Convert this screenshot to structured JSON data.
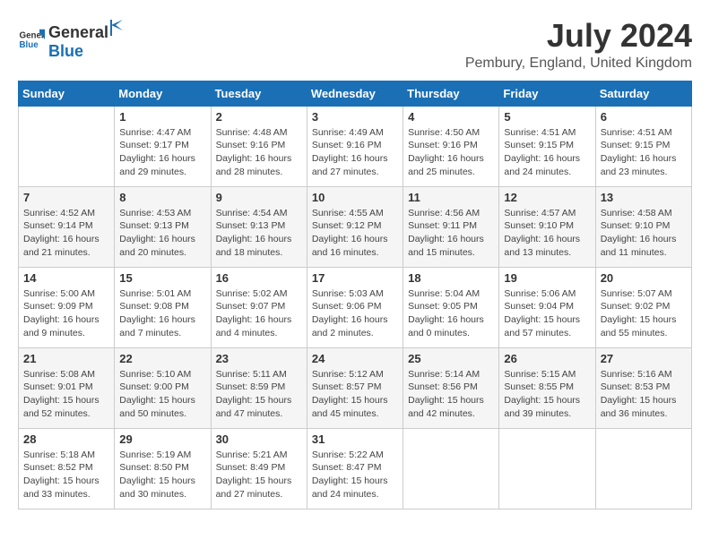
{
  "logo": {
    "general": "General",
    "blue": "Blue"
  },
  "title": "July 2024",
  "location": "Pembury, England, United Kingdom",
  "days_of_week": [
    "Sunday",
    "Monday",
    "Tuesday",
    "Wednesday",
    "Thursday",
    "Friday",
    "Saturday"
  ],
  "weeks": [
    [
      {
        "day": "",
        "info": ""
      },
      {
        "day": "1",
        "info": "Sunrise: 4:47 AM\nSunset: 9:17 PM\nDaylight: 16 hours\nand 29 minutes."
      },
      {
        "day": "2",
        "info": "Sunrise: 4:48 AM\nSunset: 9:16 PM\nDaylight: 16 hours\nand 28 minutes."
      },
      {
        "day": "3",
        "info": "Sunrise: 4:49 AM\nSunset: 9:16 PM\nDaylight: 16 hours\nand 27 minutes."
      },
      {
        "day": "4",
        "info": "Sunrise: 4:50 AM\nSunset: 9:16 PM\nDaylight: 16 hours\nand 25 minutes."
      },
      {
        "day": "5",
        "info": "Sunrise: 4:51 AM\nSunset: 9:15 PM\nDaylight: 16 hours\nand 24 minutes."
      },
      {
        "day": "6",
        "info": "Sunrise: 4:51 AM\nSunset: 9:15 PM\nDaylight: 16 hours\nand 23 minutes."
      }
    ],
    [
      {
        "day": "7",
        "info": "Sunrise: 4:52 AM\nSunset: 9:14 PM\nDaylight: 16 hours\nand 21 minutes."
      },
      {
        "day": "8",
        "info": "Sunrise: 4:53 AM\nSunset: 9:13 PM\nDaylight: 16 hours\nand 20 minutes."
      },
      {
        "day": "9",
        "info": "Sunrise: 4:54 AM\nSunset: 9:13 PM\nDaylight: 16 hours\nand 18 minutes."
      },
      {
        "day": "10",
        "info": "Sunrise: 4:55 AM\nSunset: 9:12 PM\nDaylight: 16 hours\nand 16 minutes."
      },
      {
        "day": "11",
        "info": "Sunrise: 4:56 AM\nSunset: 9:11 PM\nDaylight: 16 hours\nand 15 minutes."
      },
      {
        "day": "12",
        "info": "Sunrise: 4:57 AM\nSunset: 9:10 PM\nDaylight: 16 hours\nand 13 minutes."
      },
      {
        "day": "13",
        "info": "Sunrise: 4:58 AM\nSunset: 9:10 PM\nDaylight: 16 hours\nand 11 minutes."
      }
    ],
    [
      {
        "day": "14",
        "info": "Sunrise: 5:00 AM\nSunset: 9:09 PM\nDaylight: 16 hours\nand 9 minutes."
      },
      {
        "day": "15",
        "info": "Sunrise: 5:01 AM\nSunset: 9:08 PM\nDaylight: 16 hours\nand 7 minutes."
      },
      {
        "day": "16",
        "info": "Sunrise: 5:02 AM\nSunset: 9:07 PM\nDaylight: 16 hours\nand 4 minutes."
      },
      {
        "day": "17",
        "info": "Sunrise: 5:03 AM\nSunset: 9:06 PM\nDaylight: 16 hours\nand 2 minutes."
      },
      {
        "day": "18",
        "info": "Sunrise: 5:04 AM\nSunset: 9:05 PM\nDaylight: 16 hours\nand 0 minutes."
      },
      {
        "day": "19",
        "info": "Sunrise: 5:06 AM\nSunset: 9:04 PM\nDaylight: 15 hours\nand 57 minutes."
      },
      {
        "day": "20",
        "info": "Sunrise: 5:07 AM\nSunset: 9:02 PM\nDaylight: 15 hours\nand 55 minutes."
      }
    ],
    [
      {
        "day": "21",
        "info": "Sunrise: 5:08 AM\nSunset: 9:01 PM\nDaylight: 15 hours\nand 52 minutes."
      },
      {
        "day": "22",
        "info": "Sunrise: 5:10 AM\nSunset: 9:00 PM\nDaylight: 15 hours\nand 50 minutes."
      },
      {
        "day": "23",
        "info": "Sunrise: 5:11 AM\nSunset: 8:59 PM\nDaylight: 15 hours\nand 47 minutes."
      },
      {
        "day": "24",
        "info": "Sunrise: 5:12 AM\nSunset: 8:57 PM\nDaylight: 15 hours\nand 45 minutes."
      },
      {
        "day": "25",
        "info": "Sunrise: 5:14 AM\nSunset: 8:56 PM\nDaylight: 15 hours\nand 42 minutes."
      },
      {
        "day": "26",
        "info": "Sunrise: 5:15 AM\nSunset: 8:55 PM\nDaylight: 15 hours\nand 39 minutes."
      },
      {
        "day": "27",
        "info": "Sunrise: 5:16 AM\nSunset: 8:53 PM\nDaylight: 15 hours\nand 36 minutes."
      }
    ],
    [
      {
        "day": "28",
        "info": "Sunrise: 5:18 AM\nSunset: 8:52 PM\nDaylight: 15 hours\nand 33 minutes."
      },
      {
        "day": "29",
        "info": "Sunrise: 5:19 AM\nSunset: 8:50 PM\nDaylight: 15 hours\nand 30 minutes."
      },
      {
        "day": "30",
        "info": "Sunrise: 5:21 AM\nSunset: 8:49 PM\nDaylight: 15 hours\nand 27 minutes."
      },
      {
        "day": "31",
        "info": "Sunrise: 5:22 AM\nSunset: 8:47 PM\nDaylight: 15 hours\nand 24 minutes."
      },
      {
        "day": "",
        "info": ""
      },
      {
        "day": "",
        "info": ""
      },
      {
        "day": "",
        "info": ""
      }
    ]
  ]
}
